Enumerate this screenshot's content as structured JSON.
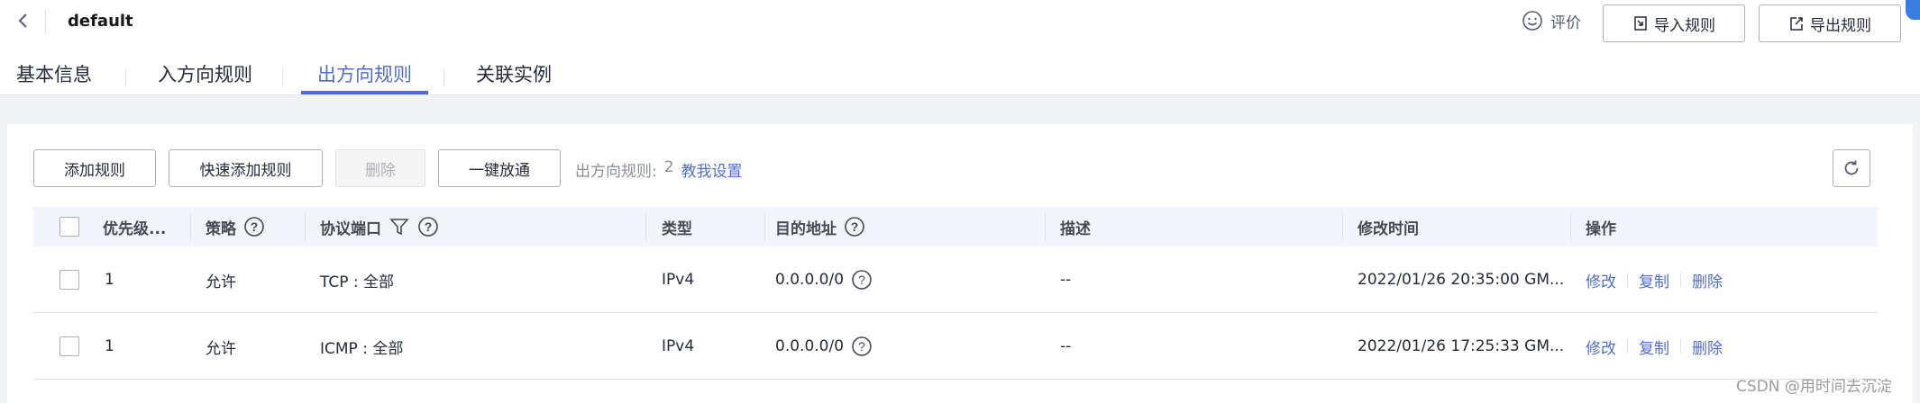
{
  "header": {
    "title": "default",
    "rate_label": "评价",
    "import_label": "导入规则",
    "export_label": "导出规则"
  },
  "tabs": [
    {
      "label": "基本信息",
      "active": false
    },
    {
      "label": "入方向规则",
      "active": false
    },
    {
      "label": "出方向规则",
      "active": true
    },
    {
      "label": "关联实例",
      "active": false
    }
  ],
  "toolbar": {
    "add_rule": "添加规则",
    "quick_add_rule": "快速添加规则",
    "delete": "删除",
    "allow_all": "一键放通",
    "rule_count_label": "出方向规则:",
    "rule_count_value": "2",
    "help_link": "教我设置"
  },
  "table": {
    "headers": {
      "priority": "优先级...",
      "policy": "策略",
      "protocol_port": "协议端口",
      "type": "类型",
      "destination": "目的地址",
      "description": "描述",
      "modified_time": "修改时间",
      "actions": "操作"
    },
    "rows": [
      {
        "priority": "1",
        "policy": "允许",
        "protocol_port": "TCP : 全部",
        "type": "IPv4",
        "destination": "0.0.0.0/0",
        "description": "--",
        "modified_time": "2022/01/26 20:35:00 GM...",
        "action_edit": "修改",
        "action_copy": "复制",
        "action_delete": "删除"
      },
      {
        "priority": "1",
        "policy": "允许",
        "protocol_port": "ICMP : 全部",
        "type": "IPv4",
        "destination": "0.0.0.0/0",
        "description": "--",
        "modified_time": "2022/01/26 17:25:33 GM...",
        "action_edit": "修改",
        "action_copy": "复制",
        "action_delete": "删除"
      }
    ]
  },
  "watermark": "CSDN @用时间去沉淀",
  "colors": {
    "accent": "#526ecc",
    "table_header_bg": "#f2f5fc",
    "page_bg": "#f2f3f5"
  }
}
